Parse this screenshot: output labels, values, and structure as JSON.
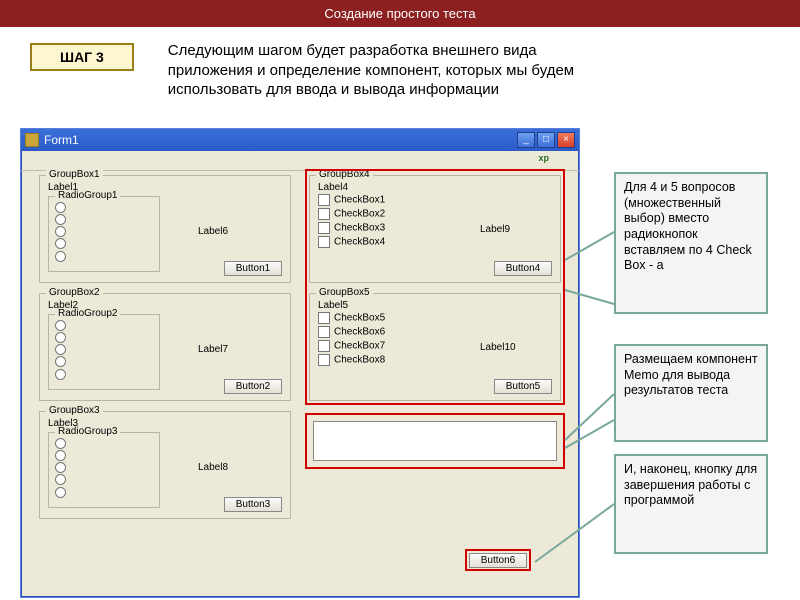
{
  "banner": "Создание простого теста",
  "step": {
    "badge": "ШАГ 3",
    "text": "   Следующим шагом будет разработка внешнего вида приложения и определение компонент, которых мы будем использовать для ввода и вывода информации"
  },
  "window": {
    "title": "Form1",
    "groups": [
      {
        "name": "GroupBox1",
        "label": "Label1",
        "radiogroup": "RadioGroup1",
        "sidelabel": "Label6",
        "button": "Button1"
      },
      {
        "name": "GroupBox2",
        "label": "Label2",
        "radiogroup": "RadioGroup2",
        "sidelabel": "Label7",
        "button": "Button2"
      },
      {
        "name": "GroupBox3",
        "label": "Label3",
        "radiogroup": "RadioGroup3",
        "sidelabel": "Label8",
        "button": "Button3"
      }
    ],
    "check_groups": [
      {
        "name": "GroupBox4",
        "label": "Label4",
        "checks": [
          "CheckBox1",
          "CheckBox2",
          "CheckBox3",
          "CheckBox4"
        ],
        "sidelabel": "Label9",
        "button": "Button4"
      },
      {
        "name": "GroupBox5",
        "label": "Label5",
        "checks": [
          "CheckBox5",
          "CheckBox6",
          "CheckBox7",
          "CheckBox8"
        ],
        "sidelabel": "Label10",
        "button": "Button5"
      }
    ],
    "final_button": "Button6"
  },
  "notes": {
    "a": "   Для 4 и 5 вопросов (множественный выбор) вместо радиокнопок вставляем по 4 Check Box - а",
    "b": "   Размещаем компонент Memo для вывода результатов теста",
    "c": "   И, наконец, кнопку для завершения работы с программой"
  }
}
